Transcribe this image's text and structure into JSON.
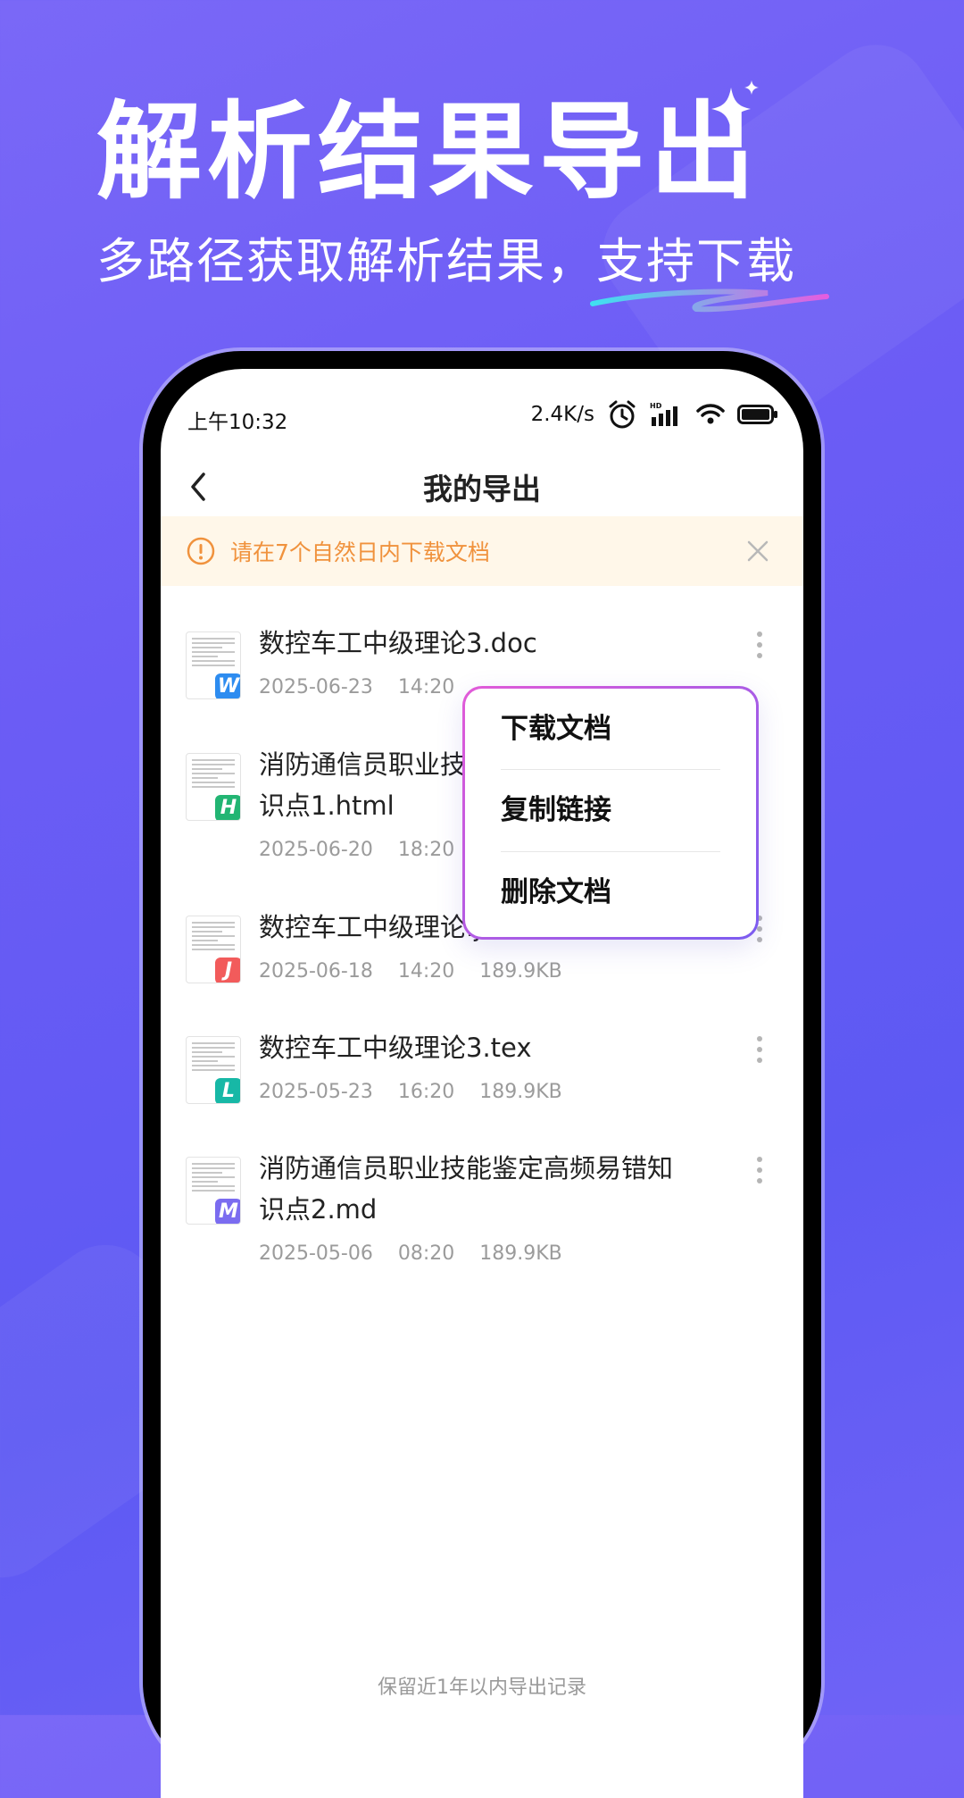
{
  "promo": {
    "headline": "解析结果导出",
    "subline": "多路径获取解析结果，支持下载",
    "accent_colors": [
      "#3fe0f0",
      "#e45de0"
    ]
  },
  "status_bar": {
    "time": "上午10:32",
    "speed": "2.4K/s",
    "icons": [
      "alarm-icon",
      "hd-signal-icon",
      "wifi-icon",
      "battery-icon"
    ]
  },
  "nav": {
    "title": "我的导出",
    "back_icon": "chevron-left-icon"
  },
  "notice": {
    "text": "请在7个自然日内下载文档",
    "icon": "info-circle-icon",
    "close_icon": "close-icon",
    "color": "#f0923d"
  },
  "files": [
    {
      "name": "数控车工中级理论3.doc",
      "date": "2025-06-23",
      "time": "14:20",
      "size": "",
      "badge": "W",
      "badge_color": "#2d8cf0"
    },
    {
      "name": "消防通信员职业技能鉴定高频易错知识点1.html",
      "name_visible_line1": "消防通信员职业技",
      "name_visible_line2": "识点1.html",
      "date": "2025-06-20",
      "time": "18:20",
      "size": "",
      "badge": "H",
      "badge_color": "#22b573"
    },
    {
      "name": "数控车工中级理论.json",
      "date": "2025-06-18",
      "time": "14:20",
      "size": "189.9KB",
      "badge": "J",
      "badge_color": "#f25b5b"
    },
    {
      "name": "数控车工中级理论3.tex",
      "date": "2025-05-23",
      "time": "16:20",
      "size": "189.9KB",
      "badge": "L",
      "badge_color": "#17b8a6"
    },
    {
      "name": "消防通信员职业技能鉴定高频易错知识点2.md",
      "name_visible_line1": "消防通信员职业技能鉴定高频易错知",
      "name_visible_line2": "识点2.md",
      "date": "2025-05-06",
      "time": "08:20",
      "size": "189.9KB",
      "badge": "M",
      "badge_color": "#7b6cf0"
    }
  ],
  "menu": {
    "items": [
      "下载文档",
      "复制链接",
      "删除文档"
    ]
  },
  "footer": {
    "note": "保留近1年以内导出记录"
  }
}
